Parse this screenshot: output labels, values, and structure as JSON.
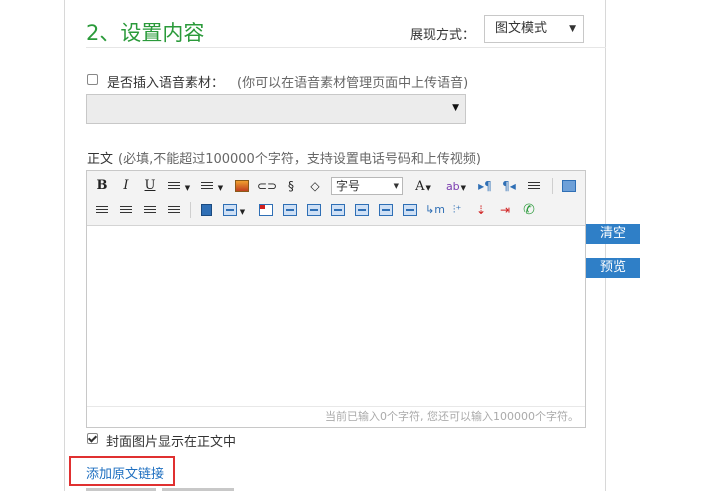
{
  "section": {
    "title": "2、设置内容"
  },
  "display": {
    "label": "展现方式：",
    "value": "图文模式"
  },
  "voice": {
    "checked": false,
    "label": "是否插入语音素材：",
    "hint": "(你可以在语音素材管理页面中上传语音)",
    "selected": ""
  },
  "body": {
    "label": "正文",
    "hint": "(必填,不能超过100000个字符，支持设置电话号码和上传视频)"
  },
  "editor": {
    "toolbar": {
      "bold": "B",
      "italic": "I",
      "underline": "U",
      "font_size_placeholder": "字号",
      "font_color": "A",
      "highlight": "ab"
    },
    "content": "",
    "counter": "当前已输入0个字符, 您还可以输入100000个字符。"
  },
  "side_buttons": {
    "clear": "清空",
    "preview": "预览"
  },
  "cover": {
    "checked": true,
    "label": "封面图片显示在正文中"
  },
  "link": {
    "label": "添加原文链接"
  },
  "colors": {
    "title_green": "#2a9a3a",
    "button_blue": "#2f7fc7",
    "link_blue": "#1e6fc0",
    "highlight_red": "#e03030"
  }
}
